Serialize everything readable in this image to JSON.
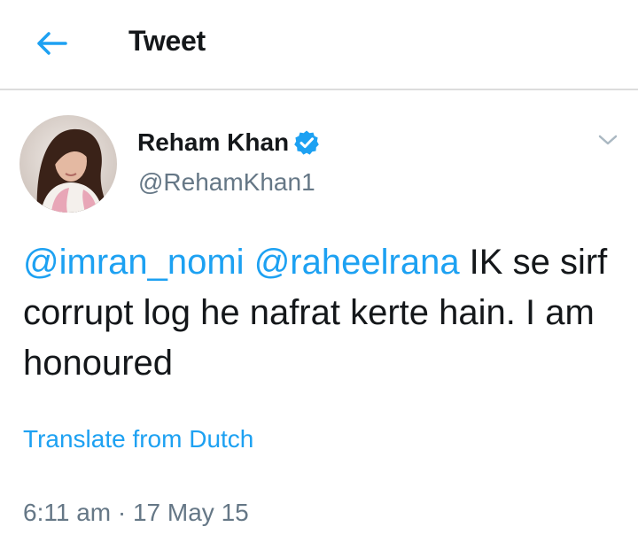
{
  "header": {
    "title": "Tweet",
    "back_icon": "arrow-left-icon"
  },
  "colors": {
    "accent": "#1da1f2",
    "text": "#14171a",
    "muted": "#657786",
    "divider": "#dcdcdc"
  },
  "tweet": {
    "author": {
      "name": "Reham Khan",
      "handle": "@RehamKhan1",
      "verified": true
    },
    "mention_1": "@imran_nomi",
    "space": " ",
    "mention_2": "@raheelrana",
    "text_after_mentions": " IK se sirf corrupt log he nafrat kerte hain. I am honoured",
    "translate_label": "Translate from Dutch",
    "timestamp": "6:11 am · 17 May 15"
  }
}
